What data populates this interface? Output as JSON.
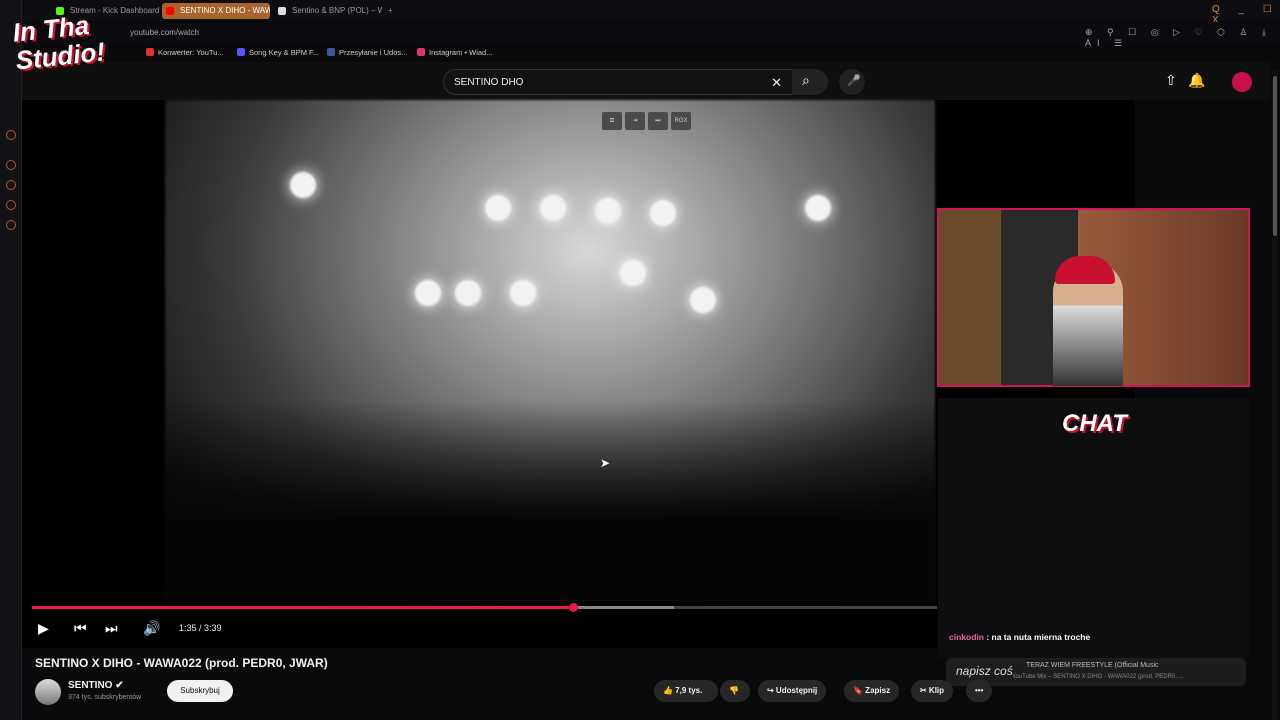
{
  "browser": {
    "tabs": [
      {
        "label": "Stream - Kick Dashboard",
        "color": "#53fc18"
      },
      {
        "label": "SENTINO X DIHO - WAWA",
        "color": "#ff0000"
      },
      {
        "label": "Sentino & BNP (POL) – WA",
        "color": "#ffffff"
      }
    ],
    "new_tab": "+",
    "address": "youtube.com/watch",
    "bookmarks": [
      {
        "label": "Konwerter: YouTu...",
        "color": "#d33"
      },
      {
        "label": "Song Key & BPM F...",
        "color": "#55f"
      },
      {
        "label": "Przesyłanie i Udos...",
        "color": "#3b5998"
      },
      {
        "label": "Instagram • Wiad...",
        "color": "#e1306c"
      }
    ],
    "window_controls": "Q _ ☐ X",
    "extension_icons": "⊕ ⚲ ☐ ◎ ▷ ♡ ⬡ ♙ ⤓ AI ☰"
  },
  "overlay": {
    "logo": "In Tha Studio!",
    "chat_label": "CHAT",
    "chat_message": {
      "user": "cinkodin",
      "text": " : na ta nuta mierna troche"
    },
    "chat_input": "napisz coś",
    "now_playing": "TERAZ WIEM FREESTYLE (Official Music",
    "now_playing_sub": "YouTube Mix – SENTINO X DIHO - WAWA022 (prod. PEDR0, ..."
  },
  "youtube": {
    "search_value": "SENTINO DHO",
    "video_tools": [
      "⧉",
      "⇥",
      "⏭",
      "RGX"
    ],
    "player": {
      "progress_percent": 59.8,
      "buffer_percent": 70.9,
      "time": "1:35 / 3:39"
    },
    "title": "SENTINO X DIHO - WAWA022 (prod. PEDR0, JWAR)",
    "channel": {
      "name": "SENTINO ✔",
      "subscribers": "374 tys. subskrybentów",
      "subscribe": "Subskrybuj"
    },
    "actions": {
      "likes": "👍 7,9 tys.",
      "dislike": "👎",
      "share": "↪ Udostępnij",
      "save": "🔖 Zapisz",
      "clip": "✂ Klip",
      "more": "•••"
    }
  },
  "colors": {
    "accent": "#e8194b",
    "overlay": "#c8102e"
  }
}
